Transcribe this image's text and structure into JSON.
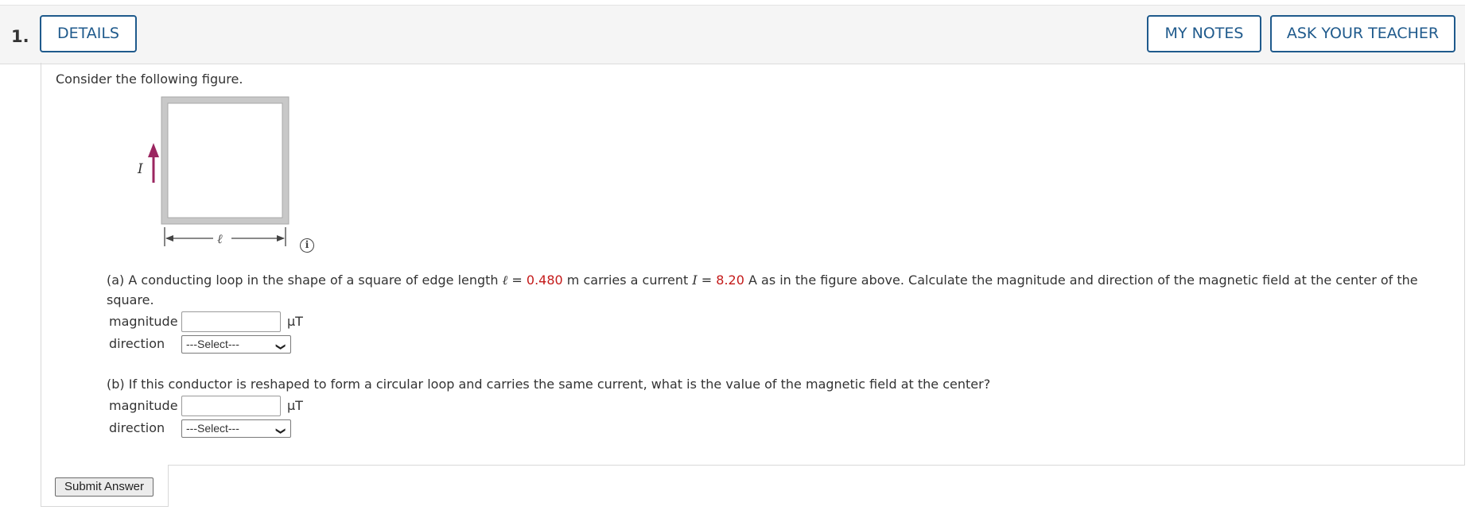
{
  "header": {
    "question_number": "1.",
    "details_label": "DETAILS",
    "my_notes_label": "MY NOTES",
    "ask_teacher_label": "ASK YOUR TEACHER"
  },
  "intro": "Consider the following figure.",
  "figure": {
    "current_label": "I",
    "length_label": "ℓ",
    "info_symbol": "i",
    "arrow_color": "#9b2660"
  },
  "part_a": {
    "text_1": "(a) A conducting loop in the shape of a square of edge length ",
    "length_symbol": "ℓ",
    "eq_1": " = ",
    "length_value": "0.480",
    "text_2": " m carries a current ",
    "current_symbol": "I",
    "eq_2": " = ",
    "current_value": "8.20",
    "text_3": " A as in the figure above. Calculate the magnitude and direction of the magnetic field at the center of the square.",
    "magnitude_label": "magnitude",
    "magnitude_value": "",
    "unit": "μT",
    "direction_label": "direction",
    "direction_selected": "---Select---"
  },
  "part_b": {
    "text": "(b) If this conductor is reshaped to form a circular loop and carries the same current, what is the value of the magnetic field at the center?",
    "magnitude_label": "magnitude",
    "magnitude_value": "",
    "unit": "μT",
    "direction_label": "direction",
    "direction_selected": "---Select---"
  },
  "submit_label": "Submit Answer",
  "colors": {
    "accent": "#1f5a8c",
    "given_value": "#c41a1a"
  }
}
